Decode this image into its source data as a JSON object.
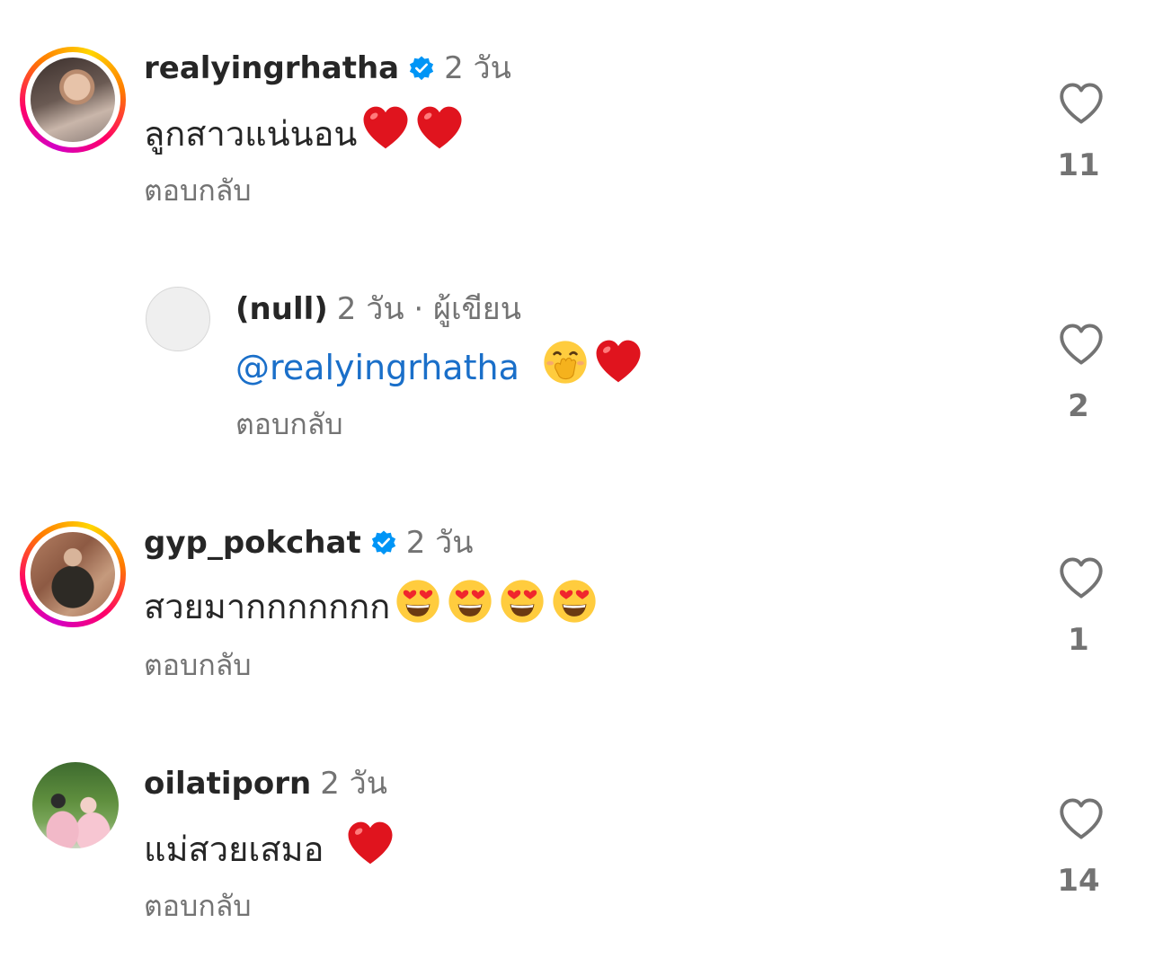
{
  "reply_label": "ตอบกลับ",
  "comments": [
    {
      "username": "realyingrhatha",
      "verified": true,
      "time": "2 วัน",
      "text": "ลูกสาวแน่นอน",
      "emojis": [
        "red-heart",
        "red-heart"
      ],
      "likes": "11",
      "avatar": "story-ring"
    },
    {
      "username": "(null)",
      "verified": false,
      "time": "2 วัน",
      "separator": "·",
      "author_badge": "ผู้เขียน",
      "mention": "@realyingrhatha",
      "emojis": [
        "hand-over-mouth-face",
        "red-heart"
      ],
      "likes": "2",
      "avatar": "placeholder"
    },
    {
      "username": "gyp_pokchat",
      "verified": true,
      "time": "2 วัน",
      "text": "สวยมากกกกกกก",
      "emojis": [
        "heart-eyes-face",
        "heart-eyes-face",
        "heart-eyes-face",
        "heart-eyes-face"
      ],
      "likes": "1",
      "avatar": "story-ring"
    },
    {
      "username": "oilatiporn",
      "verified": false,
      "time": "2 วัน",
      "text": "แม่สวยเสมอ",
      "emojis": [
        "red-heart"
      ],
      "likes": "14",
      "avatar": "photo"
    }
  ],
  "colors": {
    "verified_blue": "#0095f6",
    "mention_blue": "#1a6fc9",
    "secondary_text": "#737373",
    "heart_red": "#e0141e"
  }
}
